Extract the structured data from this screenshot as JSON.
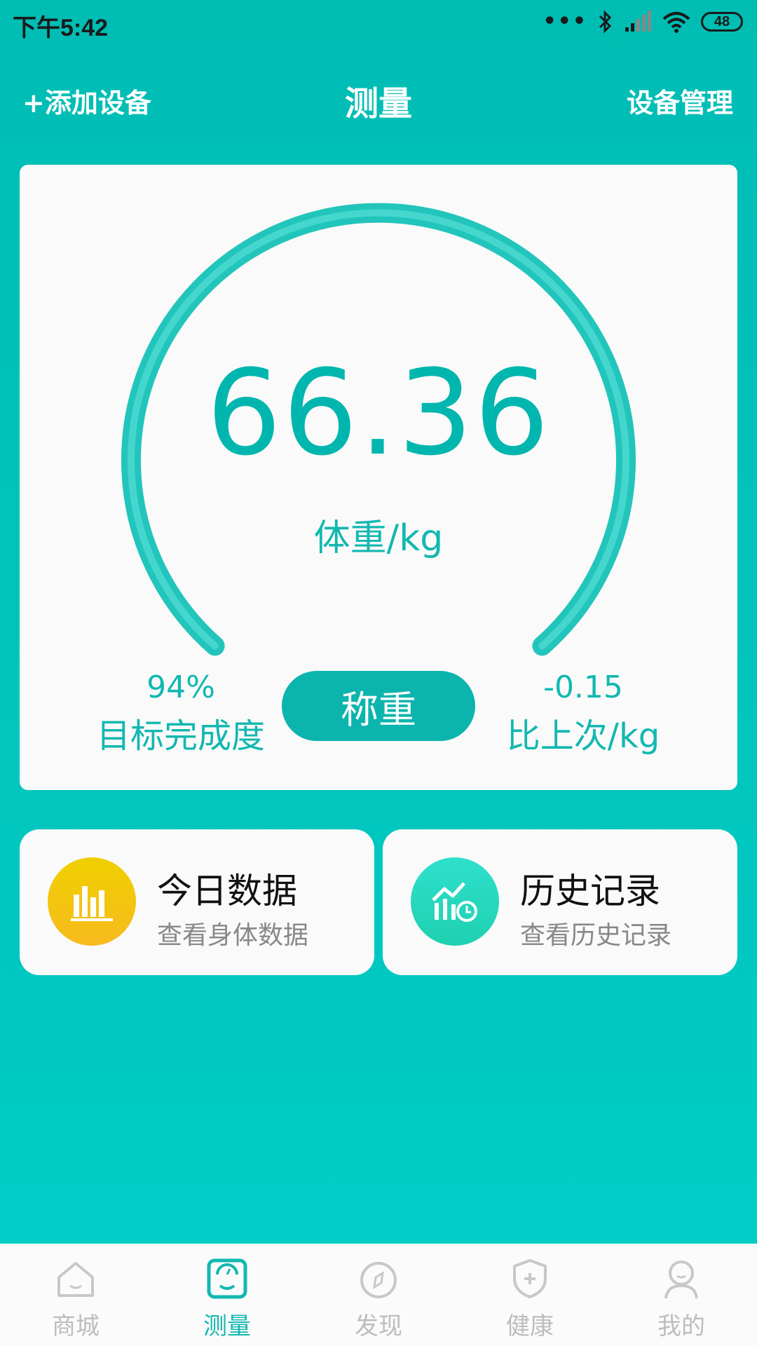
{
  "status_bar": {
    "time": "下午5:42",
    "signal_dots": "•••",
    "battery": "48"
  },
  "header": {
    "add_device": "+添加设备",
    "title": "测量",
    "device_manage": "设备管理"
  },
  "gauge": {
    "weight": "66.36",
    "unit_label": "体重/kg",
    "goal_percent": "94%",
    "goal_label": "目标完成度",
    "weigh_button": "称重",
    "diff_value": "-0.15",
    "diff_label": "比上次/kg",
    "colors": {
      "primary": "#00B6AE",
      "arc": "#2ED0C6"
    }
  },
  "cards": [
    {
      "title": "今日数据",
      "subtitle": "查看身体数据",
      "icon": "bar-chart-icon",
      "color": "#F4C60C"
    },
    {
      "title": "历史记录",
      "subtitle": "查看历史记录",
      "icon": "history-chart-icon",
      "color": "#27D8C0"
    }
  ],
  "bottom_nav": [
    {
      "label": "商城",
      "icon": "home-icon",
      "active": false
    },
    {
      "label": "测量",
      "icon": "scale-icon",
      "active": true
    },
    {
      "label": "发现",
      "icon": "compass-icon",
      "active": false
    },
    {
      "label": "健康",
      "icon": "shield-plus-icon",
      "active": false
    },
    {
      "label": "我的",
      "icon": "person-icon",
      "active": false
    }
  ]
}
